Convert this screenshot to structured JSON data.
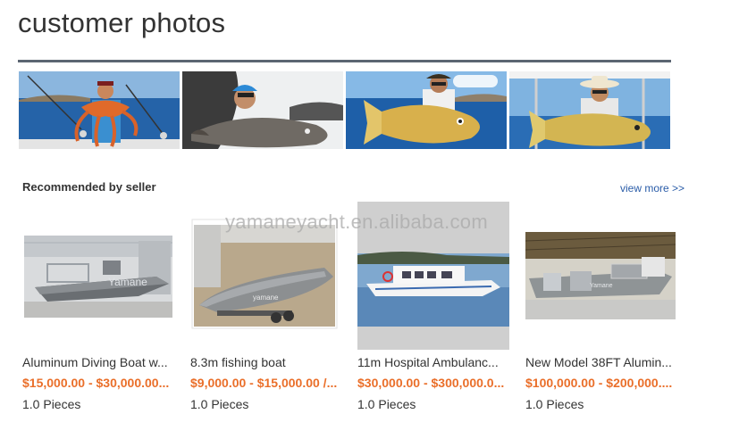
{
  "page": {
    "title": "customer photos"
  },
  "customer_photos": [
    {
      "name": "fisherman-with-octopus-photo"
    },
    {
      "name": "fisherman-with-large-fish-photo"
    },
    {
      "name": "fisherman-with-golden-fish-photo"
    },
    {
      "name": "fisherman-on-boat-with-fish-photo"
    }
  ],
  "recommended": {
    "title": "Recommended by seller",
    "view_more": "view more >>",
    "watermark": "yamaneyacht.en.alibaba.com",
    "products": [
      {
        "name": "Aluminum Diving Boat w...",
        "price": "$15,000.00 - $30,000.00...",
        "quantity": "1.0 Pieces",
        "image_label": "Yamane"
      },
      {
        "name": "8.3m fishing boat",
        "price": "$9,000.00 - $15,000.00 /...",
        "quantity": "1.0 Pieces",
        "image_label": "yamane"
      },
      {
        "name": "11m Hospital Ambulanc...",
        "price": "$30,000.00 - $300,000.0...",
        "quantity": "1.0 Pieces",
        "image_label": ""
      },
      {
        "name": "New Model 38FT Alumin...",
        "price": "$100,000.00 - $200,000....",
        "quantity": "1.0 Pieces",
        "image_label": "Yamane"
      }
    ]
  },
  "colors": {
    "rule": "#5b6672",
    "price": "#ea6f2a",
    "link": "#2a5ca8"
  }
}
